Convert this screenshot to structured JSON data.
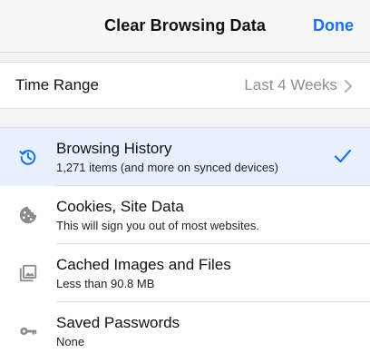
{
  "nav": {
    "title": "Clear Browsing Data",
    "done_label": "Done"
  },
  "time_range": {
    "label": "Time Range",
    "value": "Last 4 Weeks"
  },
  "items": [
    {
      "title": "Browsing History",
      "subtitle": "1,271 items (and more on synced devices)",
      "icon": "history-icon",
      "checked": true
    },
    {
      "title": "Cookies, Site Data",
      "subtitle": "This will sign you out of most websites.",
      "icon": "cookie-icon",
      "checked": false
    },
    {
      "title": "Cached Images and Files",
      "subtitle": "Less than 90.8 MB",
      "icon": "image-icon",
      "checked": false
    },
    {
      "title": "Saved Passwords",
      "subtitle": "None",
      "icon": "key-icon",
      "checked": false
    }
  ],
  "colors": {
    "accent": "#1a73e8",
    "selected_row": "#e8f0fe",
    "icon_gray": "#8a8a8e"
  }
}
